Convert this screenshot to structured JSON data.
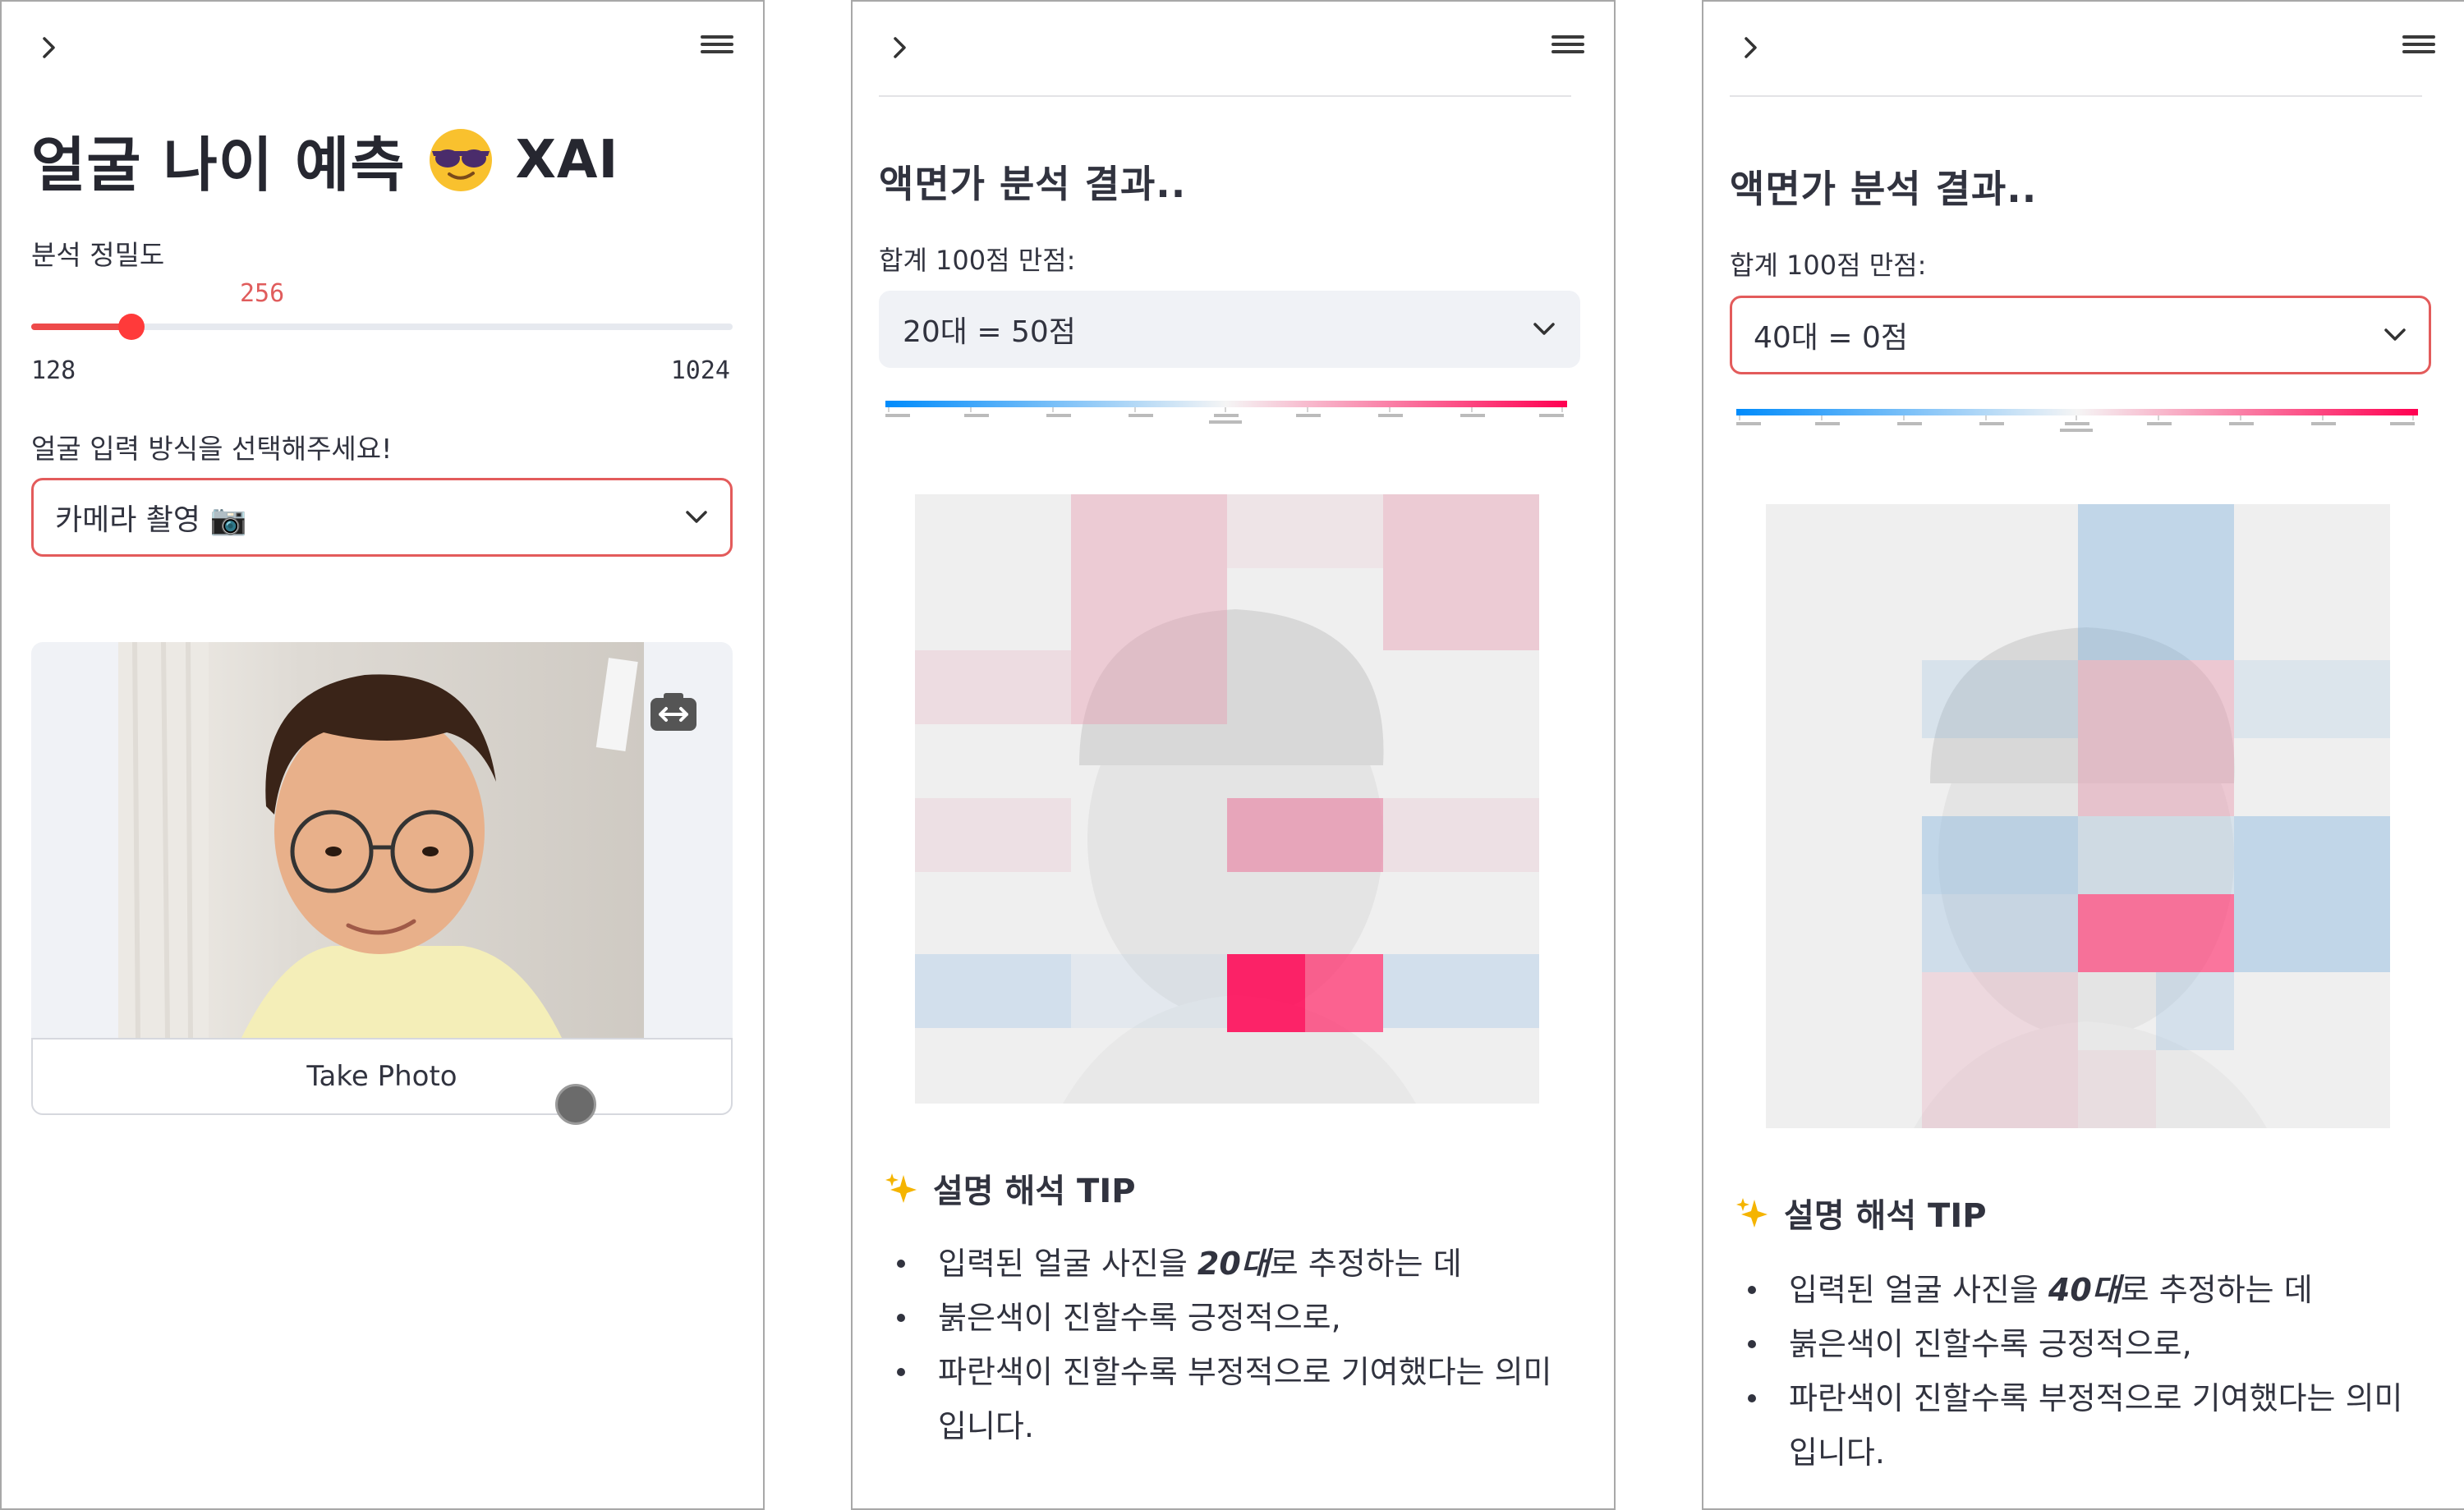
{
  "panel1": {
    "title": "얼굴 나이 예측",
    "title_suffix": "XAI",
    "slider": {
      "label": "분석 정밀도",
      "value": "256",
      "min": "128",
      "max": "1024",
      "fraction": 0.143
    },
    "input_label": "얼굴 입력 방식을 선택해주세요!",
    "input_select": {
      "value": "카메라 촬영 📷"
    },
    "take_photo": "Take Photo"
  },
  "panel2": {
    "heading": "액면가 분석 결과..",
    "score_label": "합계 100점 만점:",
    "select_value": "20대 = 50점",
    "tip_title": "설명 해석 TIP",
    "tips": {
      "t1_pre": "입력된 얼굴 사진을 ",
      "t1_em": "20대",
      "t1_post": "로 추정하는 데",
      "t2": "붉은색이 진할수록 긍정적으로,",
      "t3": "파란색이 진할수록 부정적으로 기여했다는 의미입니다."
    }
  },
  "panel3": {
    "heading": "액면가 분석 결과..",
    "score_label": "합계 100점 만점:",
    "select_value": "40대 = 0점",
    "tip_title": "설명 해석 TIP",
    "tips": {
      "t1_pre": "입력된 얼굴 사진을 ",
      "t1_em": "40대",
      "t1_post": "로 추정하는 데",
      "t2": "붉은색이 진할수록 긍정적으로,",
      "t3": "파란색이 진할수록 부정적으로 기여했다는 의미입니다."
    }
  },
  "colors": {
    "accent": "#ff4b4b",
    "positive": "#ff0051",
    "negative": "#008bfb"
  },
  "icons": [
    "chevron-right-icon",
    "hamburger-menu-icon",
    "sunglasses-emoji-icon",
    "camera-emoji-icon",
    "chevron-down-icon",
    "camera-switch-icon",
    "sparkles-icon"
  ]
}
